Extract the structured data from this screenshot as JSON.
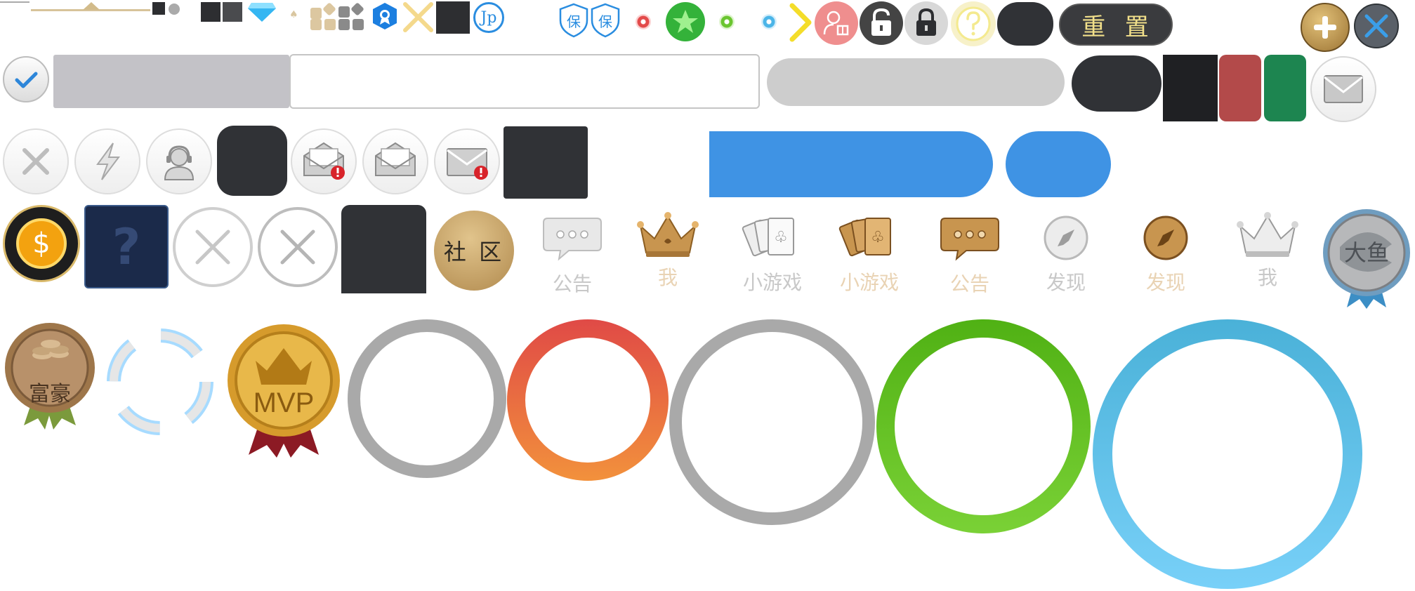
{
  "colors": {
    "gold": "#c8a15a",
    "dark": "#2f3033",
    "blue_btn": "#3f93e4",
    "ring_gray": "#a9a9a9",
    "ring_red_top": "#e04a46",
    "ring_red_bottom": "#f2913c",
    "ring_green": "#58b71d",
    "ring_blue": "#5ec6ec",
    "gray_input": "#c3c2c7",
    "gray_pill": "#cdcdcd",
    "red_swatch": "#b34a4a",
    "green_swatch": "#1d8550"
  },
  "top_row": {
    "reset_label": "重  置",
    "jp_label": "Jp",
    "bao_label_1": "保",
    "bao_label_2": "保"
  },
  "row4": {
    "community_label": "社 区",
    "question_mark": "?",
    "tabs": [
      {
        "label": "公告",
        "style": "gray",
        "icon": "chat-bubble-icon"
      },
      {
        "label": "我",
        "style": "gold",
        "icon": "crown-icon"
      },
      {
        "label": "小游戏",
        "style": "gray",
        "icon": "cards-icon"
      },
      {
        "label": "小游戏",
        "style": "gold",
        "icon": "cards-icon"
      },
      {
        "label": "公告",
        "style": "gold",
        "icon": "chat-bubble-icon"
      },
      {
        "label": "发现",
        "style": "gray",
        "icon": "compass-icon"
      },
      {
        "label": "发现",
        "style": "gold",
        "icon": "compass-icon"
      },
      {
        "label": "我",
        "style": "gray",
        "icon": "crown-icon"
      }
    ],
    "big_fish_label": "大鱼"
  },
  "row5": {
    "rich_label": "富豪",
    "mvp_label": "MVP"
  }
}
